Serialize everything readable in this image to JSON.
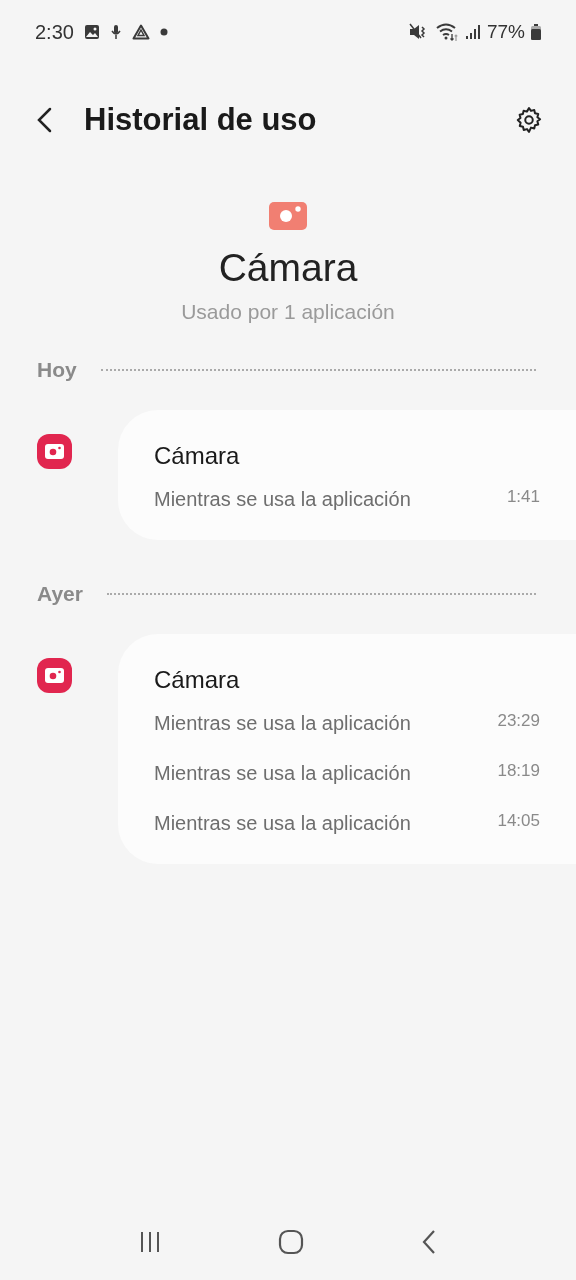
{
  "status_bar": {
    "time": "2:30",
    "battery": "77%"
  },
  "header": {
    "title": "Historial de uso"
  },
  "hero": {
    "title": "Cámara",
    "subtitle": "Usado por 1 aplicación"
  },
  "sections": [
    {
      "label": "Hoy",
      "apps": [
        {
          "name": "Cámara",
          "entries": [
            {
              "text": "Mientras se usa la aplicación",
              "time": "1:41"
            }
          ]
        }
      ]
    },
    {
      "label": "Ayer",
      "apps": [
        {
          "name": "Cámara",
          "entries": [
            {
              "text": "Mientras se usa la aplicación",
              "time": "23:29"
            },
            {
              "text": "Mientras se usa la aplicación",
              "time": "18:19"
            },
            {
              "text": "Mientras se usa la aplicación",
              "time": "14:05"
            }
          ]
        }
      ]
    }
  ]
}
